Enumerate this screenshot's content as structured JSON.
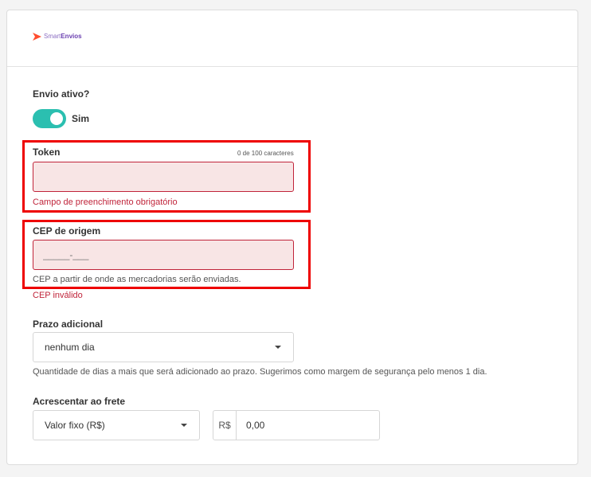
{
  "brand": {
    "logo_light": "Smart",
    "logo_bold": "Envios"
  },
  "envio_ativo": {
    "label": "Envio ativo?",
    "toggle_text": "Sim",
    "on": true
  },
  "token": {
    "label": "Token",
    "char_count": "0 de 100 caracteres",
    "value": "",
    "error": "Campo de preenchimento obrigatório"
  },
  "cep": {
    "label": "CEP de origem",
    "placeholder": "_____-___",
    "help": "CEP a partir de onde as mercadorias serão enviadas.",
    "error": "CEP inválido"
  },
  "prazo": {
    "label": "Prazo adicional",
    "selected": "nenhum dia",
    "help": "Quantidade de dias a mais que será adicionado ao prazo. Sugerimos como margem de segurança pelo menos 1 dia."
  },
  "frete": {
    "label": "Acrescentar ao frete",
    "type_selected": "Valor fixo (R$)",
    "currency_prefix": "R$",
    "value": "0,00"
  },
  "colors": {
    "toggle_on": "#2bbfb0",
    "error": "#c0243a",
    "error_bg": "#f8e5e5",
    "highlight": "#ee0000",
    "brand": "#6a3fb0",
    "brand_mark": "#ff4d2e"
  }
}
